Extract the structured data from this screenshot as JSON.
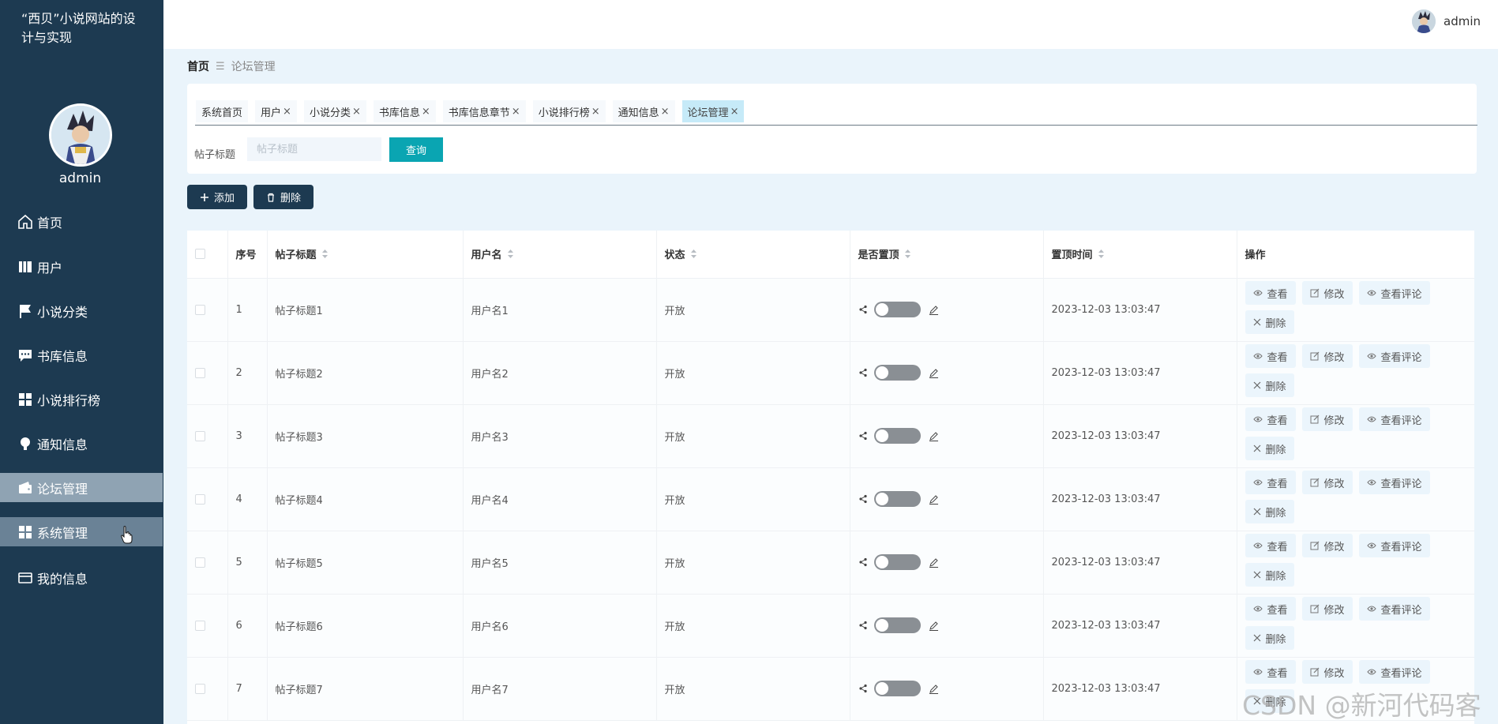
{
  "brand": {
    "title": "“西贝”小说网站的设计与实现"
  },
  "sidebar": {
    "username": "admin",
    "items": [
      {
        "label": "首页",
        "icon": "home-icon"
      },
      {
        "label": "用户",
        "icon": "user-book-icon"
      },
      {
        "label": "小说分类",
        "icon": "flag-icon"
      },
      {
        "label": "书库信息",
        "icon": "chat-icon"
      },
      {
        "label": "小说排行榜",
        "icon": "grid-icon"
      },
      {
        "label": "通知信息",
        "icon": "bulb-icon"
      },
      {
        "label": "论坛管理",
        "icon": "wallet-icon"
      },
      {
        "label": "系统管理",
        "icon": "grid-icon"
      },
      {
        "label": "我的信息",
        "icon": "card-icon"
      }
    ]
  },
  "header": {
    "username": "admin"
  },
  "breadcrumb": {
    "home": "首页",
    "separator": "☰",
    "current": "论坛管理"
  },
  "tabs": [
    {
      "label": "系统首页",
      "closable": false
    },
    {
      "label": "用户",
      "closable": true
    },
    {
      "label": "小说分类",
      "closable": true
    },
    {
      "label": "书库信息",
      "closable": true
    },
    {
      "label": "书库信息章节",
      "closable": true
    },
    {
      "label": "小说排行榜",
      "closable": true
    },
    {
      "label": "通知信息",
      "closable": true
    },
    {
      "label": "论坛管理",
      "closable": true,
      "active": true
    }
  ],
  "search": {
    "label": "帖子标题",
    "placeholder": "帖子标题",
    "value": "",
    "button": "查询"
  },
  "actions": {
    "add": "添加",
    "delete": "删除"
  },
  "table": {
    "headers": {
      "index": "序号",
      "title": "帖子标题",
      "username": "用户名",
      "status": "状态",
      "pinned": "是否置顶",
      "pin_time": "置顶时间",
      "ops": "操作"
    },
    "op_labels": {
      "view": "查看",
      "edit": "修改",
      "comments": "查看评论",
      "delete": "删除"
    },
    "rows": [
      {
        "index": "1",
        "title": "帖子标题1",
        "username": "用户名1",
        "status": "开放",
        "pin_time": "2023-12-03 13:03:47"
      },
      {
        "index": "2",
        "title": "帖子标题2",
        "username": "用户名2",
        "status": "开放",
        "pin_time": "2023-12-03 13:03:47"
      },
      {
        "index": "3",
        "title": "帖子标题3",
        "username": "用户名3",
        "status": "开放",
        "pin_time": "2023-12-03 13:03:47"
      },
      {
        "index": "4",
        "title": "帖子标题4",
        "username": "用户名4",
        "status": "开放",
        "pin_time": "2023-12-03 13:03:47"
      },
      {
        "index": "5",
        "title": "帖子标题5",
        "username": "用户名5",
        "status": "开放",
        "pin_time": "2023-12-03 13:03:47"
      },
      {
        "index": "6",
        "title": "帖子标题6",
        "username": "用户名6",
        "status": "开放",
        "pin_time": "2023-12-03 13:03:47"
      },
      {
        "index": "7",
        "title": "帖子标题7",
        "username": "用户名7",
        "status": "开放",
        "pin_time": "2023-12-03 13:03:47"
      }
    ]
  },
  "watermark": "CSDN @新河代码客",
  "colors": {
    "sidebar": "#1d3a51",
    "accent": "#0aa5b2",
    "active_menu": "#8fa3b3",
    "active_tab": "#c6eaf8"
  }
}
